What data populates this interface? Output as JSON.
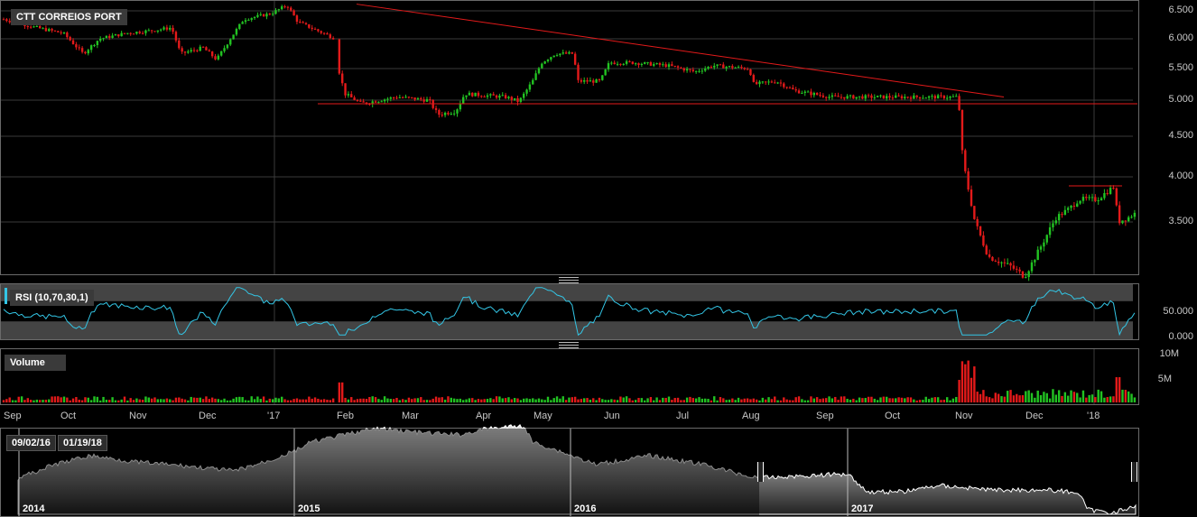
{
  "symbol_label": "CTT CORREIOS PORT",
  "rsi_label": "RSI (10,70,30,1)",
  "volume_label": "Volume",
  "colors": {
    "up": "#22c322",
    "down": "#e31a1a",
    "rsi": "#33c6e6",
    "trend": "#e31a1a",
    "grid": "#3a3a3a",
    "nav_fill_top": "#e8e8e8",
    "nav_fill_bottom": "#222222"
  },
  "price_ticks": [
    "6.500",
    "6.000",
    "5.500",
    "5.000",
    "4.500",
    "4.000",
    "3.500"
  ],
  "rsi_ticks": [
    "50.000",
    "0.000"
  ],
  "volume_ticks": [
    "10M",
    "5M"
  ],
  "x_ticks": [
    "Sep",
    "Oct",
    "Nov",
    "Dec",
    "'17",
    "Feb",
    "Mar",
    "Apr",
    "May",
    "Jun",
    "Jul",
    "Aug",
    "Sep",
    "Oct",
    "Nov",
    "Dec",
    "'18"
  ],
  "navigator": {
    "range_start": "09/02/16",
    "range_end": "01/19/18",
    "years": [
      "2014",
      "2015",
      "2016",
      "2017"
    ]
  },
  "chart_data": {
    "type": "candlestick",
    "title": "CTT CORREIOS PORT",
    "price_range": [
      3.0,
      6.6
    ],
    "rsi_range": [
      0,
      100
    ],
    "volume_range": [
      0,
      11000000
    ],
    "period": [
      "09/02/16",
      "01/19/18"
    ],
    "monthly_close_approx": [
      {
        "x": "Sep",
        "y": 6.35
      },
      {
        "x": "Oct",
        "y": 6.1
      },
      {
        "x": "Nov",
        "y": 6.1
      },
      {
        "x": "Dec",
        "y": 6.1
      },
      {
        "x": "'17",
        "y": 6.55
      },
      {
        "x": "Feb",
        "y": 5.0
      },
      {
        "x": "Mar",
        "y": 4.8
      },
      {
        "x": "Apr",
        "y": 5.1
      },
      {
        "x": "May",
        "y": 5.85
      },
      {
        "x": "Jun",
        "y": 5.6
      },
      {
        "x": "Jul",
        "y": 5.55
      },
      {
        "x": "Aug",
        "y": 5.3
      },
      {
        "x": "Sep",
        "y": 5.05
      },
      {
        "x": "Oct",
        "y": 5.05
      },
      {
        "x": "Nov",
        "y": 4.4
      },
      {
        "x": "Dec",
        "y": 3.2
      },
      {
        "x": "'18",
        "y": 3.6
      }
    ],
    "trendlines": [
      {
        "name": "descending resistance",
        "from": {
          "x": "Oct",
          "y": 6.62
        },
        "to": {
          "x": "Nov",
          "y": 5.05
        }
      },
      {
        "name": "support",
        "y": 4.95
      },
      {
        "name": "short resistance",
        "y": 3.9
      }
    ]
  }
}
